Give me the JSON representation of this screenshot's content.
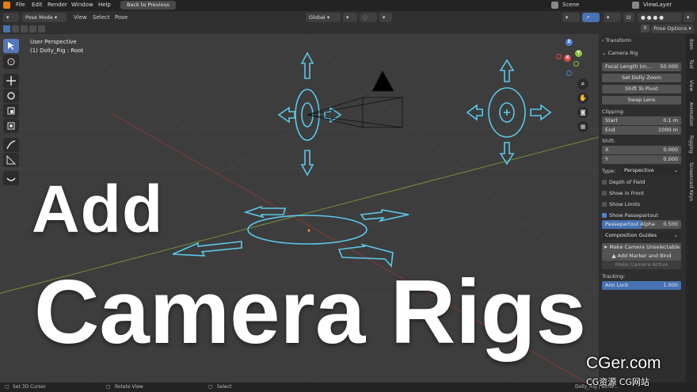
{
  "menu": {
    "items": [
      "File",
      "Edit",
      "Render",
      "Window",
      "Help"
    ],
    "back_button": "Back to Previous",
    "scene": "Scene",
    "view_layer": "ViewLayer"
  },
  "header": {
    "mode": "Pose Mode",
    "menus": [
      "View",
      "Select",
      "Pose"
    ],
    "orientation": "Global",
    "pose_options": "Pose Options"
  },
  "viewport": {
    "perspective": "User Perspective",
    "object_info": "(1) Dolly_Rig : Root",
    "gizmo_axes": [
      "Z",
      "Y",
      "X"
    ]
  },
  "overlay": {
    "line1": "Add",
    "line2": "Camera Rigs"
  },
  "panel": {
    "section_transform": "Transform",
    "section_camera_rig": "Camera Rig",
    "focal_length": {
      "label": "Focal Length (m...",
      "value": "50.000"
    },
    "buttons": [
      "Set Dolly Zoom",
      "Shift To Pivot",
      "Swap Lens"
    ],
    "clipping_label": "Clipping:",
    "clip_start": {
      "label": "Start",
      "value": "0.1 m"
    },
    "clip_end": {
      "label": "End",
      "value": "1000 m"
    },
    "shift_label": "Shift:",
    "shift_x": {
      "label": "X",
      "value": "0.000"
    },
    "shift_y": {
      "label": "Y",
      "value": "0.000"
    },
    "type_label": "Type:",
    "type_value": "Perspective",
    "checks": [
      {
        "label": "Depth of Field",
        "checked": false
      },
      {
        "label": "Show in Front",
        "checked": false
      },
      {
        "label": "Show Limits",
        "checked": false
      },
      {
        "label": "Show Passepartout",
        "checked": true
      }
    ],
    "passepartout": {
      "label": "Passepartout Alpha",
      "value": "0.500",
      "fraction": 0.5
    },
    "composition_guides": "Composition Guides",
    "make_unselectable": "Make Camera Unselectable",
    "add_marker": "Add Marker and Bind",
    "make_active": "Make Camera Active",
    "tracking_label": "Tracking:",
    "aim_lock": {
      "label": "Aim Lock",
      "value": "1.000",
      "fraction": 1.0
    }
  },
  "tabs": [
    "Item",
    "Tool",
    "View",
    "Animation",
    "Rigging",
    "Screencast Keys"
  ],
  "status": {
    "left": "Set 3D Cursor",
    "middle": "Rotate View",
    "right": "Select",
    "far_right": "Dolly_Rig | Bone..."
  },
  "watermark": {
    "main": "CGer.com",
    "sub": "CG资源 CG网站"
  },
  "colors": {
    "accent": "#4772b3",
    "rig_outline": "#5bc8e8",
    "axis_x": "#e04a4a",
    "axis_y": "#8cc63f",
    "axis_z": "#4a7fe0"
  }
}
